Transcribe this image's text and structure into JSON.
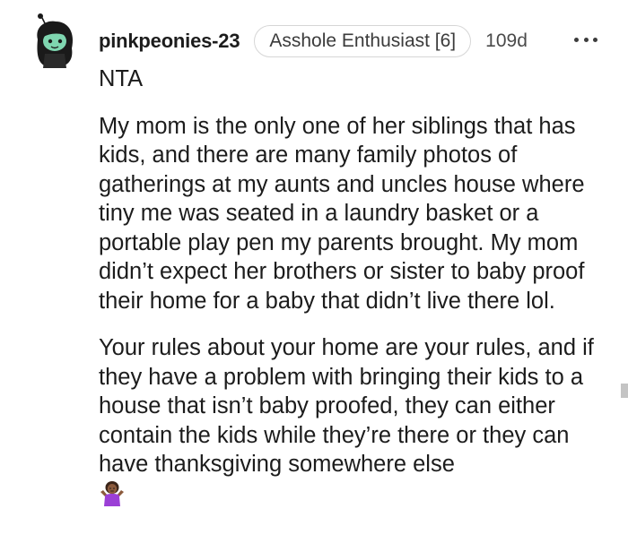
{
  "comment": {
    "author": "pinkpeonies-23",
    "flair": "Asshole Enthusiast [6]",
    "age": "109d",
    "icons": {
      "avatar": "snoo-avatar-icon",
      "more": "more-options-icon",
      "emoji": "woman-shrugging-emoji-icon"
    },
    "colors": {
      "text": "#1c1c1c",
      "flair_border": "#d6d6d6",
      "avatar_hair": "#1a1a1a",
      "avatar_skin": "#7fd6b0",
      "emoji_skin": "#8b5a3c",
      "emoji_shirt": "#9b3fd6"
    },
    "paragraphs": [
      "NTA",
      "My mom is the only one of her siblings that has kids, and there are many family photos of gatherings at my aunts and uncles house where tiny me was seated in a laundry basket or a portable play pen my parents brought. My mom didn’t expect her brothers or sister to baby proof their home for a baby that didn’t live there lol.",
      "Your rules about your home are your rules, and if they have a problem with bringing their kids to a house that isn’t baby proofed, they can either contain the kids while they’re there or they can have thanksgiving somewhere else"
    ]
  }
}
